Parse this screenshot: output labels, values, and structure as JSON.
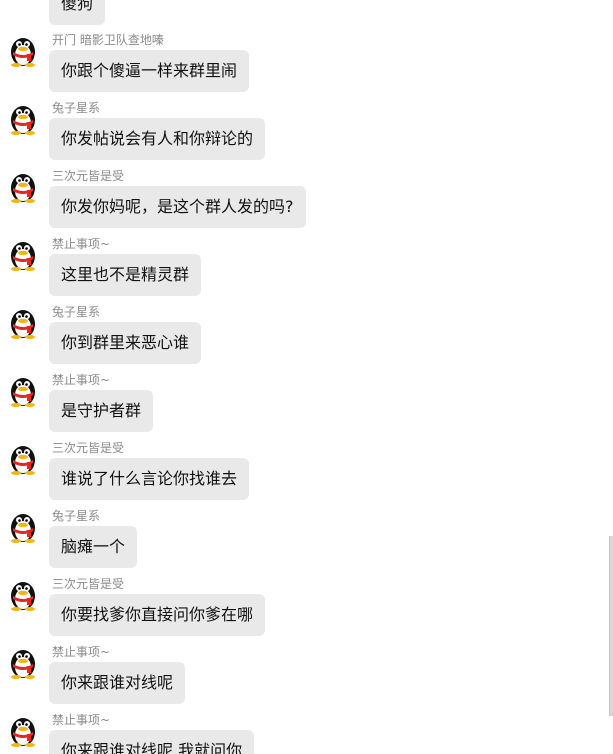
{
  "messages": [
    {
      "sender": "",
      "text": "傻狗",
      "avatar_icon": "qq-penguin-icon"
    },
    {
      "sender": "开门 暗影卫队查地嗪",
      "text": "你跟个傻逼一样来群里闹",
      "avatar_icon": "qq-penguin-icon"
    },
    {
      "sender": "兔子星系",
      "text": "你发帖说会有人和你辩论的",
      "avatar_icon": "qq-penguin-icon"
    },
    {
      "sender": "三次元皆是受",
      "text": "你发你妈呢，是这个群人发的吗?",
      "avatar_icon": "qq-penguin-icon"
    },
    {
      "sender": "禁止事项~",
      "text": "这里也不是精灵群",
      "avatar_icon": "qq-penguin-icon"
    },
    {
      "sender": "兔子星系",
      "text": "你到群里来恶心谁",
      "avatar_icon": "qq-penguin-icon"
    },
    {
      "sender": "禁止事项~",
      "text": "是守护者群",
      "avatar_icon": "qq-penguin-icon"
    },
    {
      "sender": "三次元皆是受",
      "text": "谁说了什么言论你找谁去",
      "avatar_icon": "qq-penguin-icon"
    },
    {
      "sender": "兔子星系",
      "text": "脑瘫一个",
      "avatar_icon": "qq-penguin-icon"
    },
    {
      "sender": "三次元皆是受",
      "text": "你要找爹你直接问你爹在哪",
      "avatar_icon": "qq-penguin-icon"
    },
    {
      "sender": "禁止事项~",
      "text": "你来跟谁对线呢",
      "avatar_icon": "qq-penguin-icon"
    },
    {
      "sender": "禁止事项~",
      "text": "你来跟谁对线呢 我就问你",
      "avatar_icon": "qq-penguin-icon"
    }
  ],
  "colors": {
    "bubble_bg": "#e9e9e9",
    "sender_text": "#8b8b8b",
    "message_text": "#111111"
  }
}
